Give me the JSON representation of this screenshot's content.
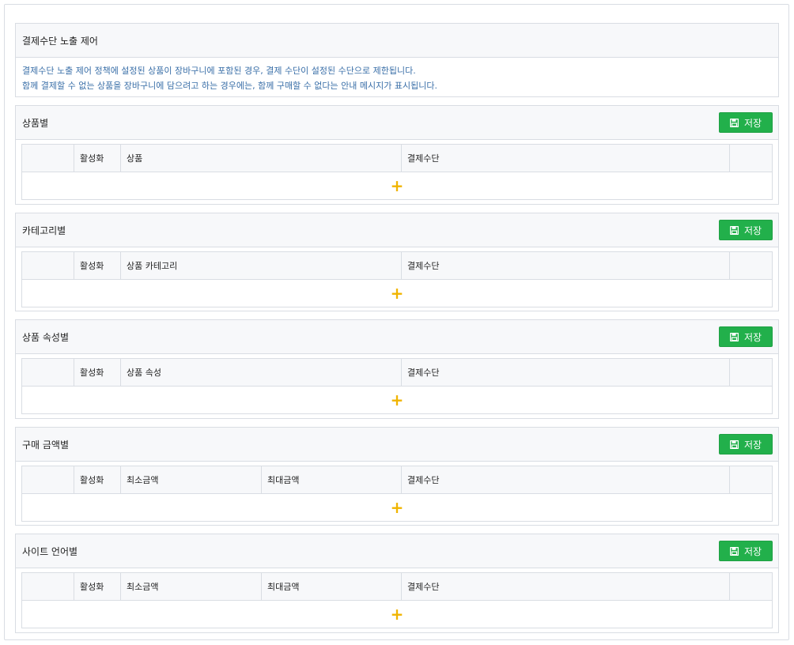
{
  "notice": {
    "title": "결제수단 노출 제어",
    "lines": [
      "결제수단 노출 제어 정책에 설정된 상품이 장바구니에 포함된 경우, 결제 수단이 설정된 수단으로 제한됩니다.",
      "함께 결제할 수 없는 상품을 장바구니에 담으려고 하는 경우에는, 함께 구매할 수 없다는 안내 메시지가 표시됩니다."
    ]
  },
  "sections": [
    {
      "title": "상품별",
      "save_label": "저장",
      "columns": [
        "",
        "활성화",
        "상품",
        "결제수단",
        ""
      ]
    },
    {
      "title": "카테고리별",
      "save_label": "저장",
      "columns": [
        "",
        "활성화",
        "상품 카테고리",
        "결제수단",
        ""
      ]
    },
    {
      "title": "상품 속성별",
      "save_label": "저장",
      "columns": [
        "",
        "활성화",
        "상품 속성",
        "결제수단",
        ""
      ]
    },
    {
      "title": "구매 금액별",
      "save_label": "저장",
      "columns": [
        "",
        "활성화",
        "최소금액",
        "최대금액",
        "결제수단",
        ""
      ]
    },
    {
      "title": "사이트 언어별",
      "save_label": "저장",
      "columns": [
        "",
        "활성화",
        "최소금액",
        "최대금액",
        "결제수단",
        ""
      ]
    }
  ],
  "icons": {
    "save": "floppy-disk-icon",
    "add": "plus-icon"
  },
  "add_symbol": "+",
  "colors": {
    "save_button": "#22b04b",
    "add_icon": "#f0b400",
    "notice_text": "#3a6fa8",
    "header_bg": "#f7f8fa",
    "border": "#d9dde3"
  }
}
